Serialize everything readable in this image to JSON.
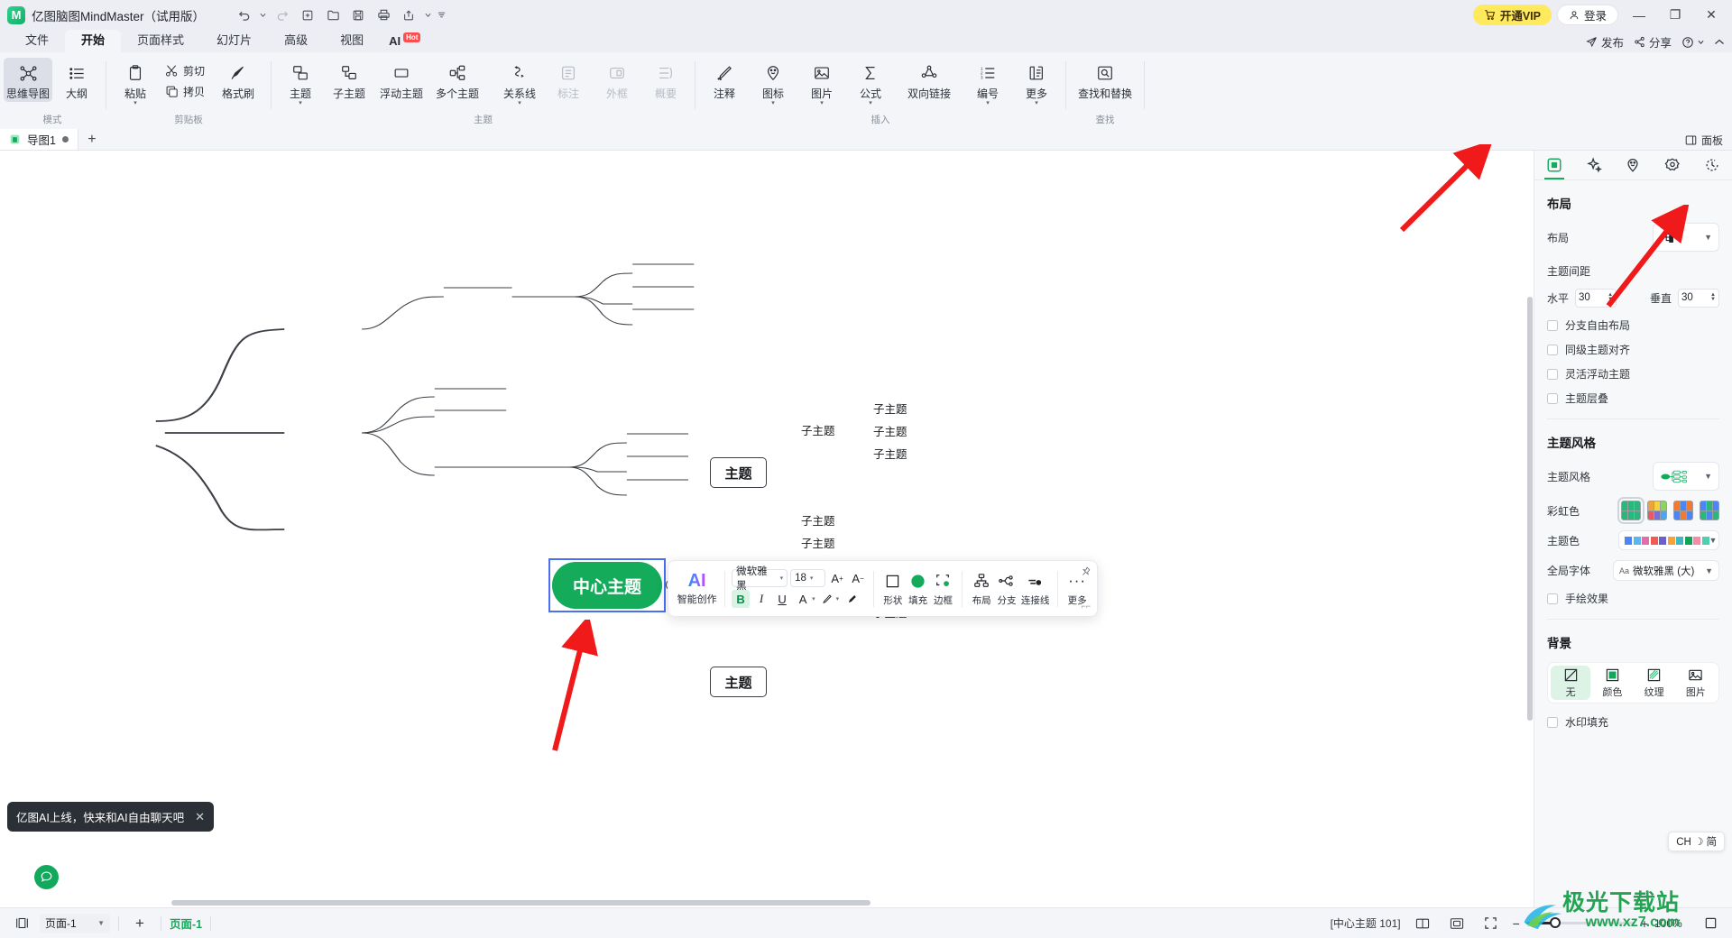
{
  "titlebar": {
    "app_title": "亿图脑图MindMaster（试用版）",
    "logo_glyph": "M",
    "quick_access": [
      {
        "name": "undo-icon",
        "glyph": "↺"
      },
      {
        "name": "undo-dropdown-icon",
        "glyph": "▾"
      },
      {
        "name": "redo-icon",
        "glyph": "↻"
      },
      {
        "name": "new-icon",
        "glyph": "＋"
      },
      {
        "name": "open-icon",
        "glyph": "🗁"
      },
      {
        "name": "save-icon",
        "glyph": "🖫"
      },
      {
        "name": "print-icon",
        "glyph": "🖨"
      },
      {
        "name": "export-icon",
        "glyph": "↗"
      },
      {
        "name": "export-dropdown-icon",
        "glyph": "▾"
      },
      {
        "name": "more-qat-icon",
        "glyph": "⩲"
      }
    ],
    "vip_label": "开通VIP",
    "login_label": "登录",
    "minimize": "—",
    "maximize": "❐",
    "close": "✕"
  },
  "menubar": {
    "items": [
      "文件",
      "开始",
      "页面样式",
      "幻灯片",
      "高级",
      "视图"
    ],
    "active": "开始",
    "ai_label": "AI",
    "ai_badge": "Hot",
    "right_items": [
      {
        "name": "publish",
        "label": "发布",
        "icon": "send-icon"
      },
      {
        "name": "share",
        "label": "分享",
        "icon": "share-icon"
      },
      {
        "name": "help",
        "label": "",
        "icon": "help-icon"
      },
      {
        "name": "collapse-ribbon",
        "label": "",
        "icon": "chevron-up-icon"
      }
    ]
  },
  "ribbon": {
    "groups": [
      {
        "label": "模式",
        "items": [
          {
            "name": "mindmap-mode",
            "label": "思维导图",
            "icon": "mindmap-icon",
            "active": true,
            "caret": false
          },
          {
            "name": "outline-mode",
            "label": "大纲",
            "icon": "outline-icon",
            "active": false,
            "caret": false
          }
        ]
      },
      {
        "label": "剪贴板",
        "items": [
          {
            "name": "paste",
            "label": "粘贴",
            "icon": "paste-icon",
            "caret": true
          },
          {
            "name": "cut",
            "label": "剪切",
            "icon": "scissors-icon",
            "caret": false
          },
          {
            "name": "copy",
            "label": "拷贝",
            "icon": "copy-icon",
            "caret": false
          },
          {
            "name": "format-painter",
            "label": "格式刷",
            "icon": "brush-icon",
            "caret": false
          }
        ]
      },
      {
        "label": "主题",
        "items": [
          {
            "name": "topic",
            "label": "主题",
            "icon": "topic-icon",
            "caret": true
          },
          {
            "name": "subtopic",
            "label": "子主题",
            "icon": "subtopic-icon",
            "caret": false
          },
          {
            "name": "floating-topic",
            "label": "浮动主题",
            "icon": "floating-topic-icon",
            "caret": false
          },
          {
            "name": "multi-topic",
            "label": "多个主题",
            "icon": "multi-topic-icon",
            "caret": false
          },
          {
            "name": "relation-line",
            "label": "关系线",
            "icon": "relation-line-icon",
            "caret": true
          },
          {
            "name": "callout",
            "label": "标注",
            "icon": "callout-icon",
            "caret": false,
            "disabled": true
          },
          {
            "name": "boundary",
            "label": "外框",
            "icon": "boundary-icon",
            "caret": false,
            "disabled": true
          },
          {
            "name": "summary",
            "label": "概要",
            "icon": "summary-icon",
            "caret": false,
            "disabled": true
          }
        ]
      },
      {
        "label": "插入",
        "items": [
          {
            "name": "comment",
            "label": "注释",
            "icon": "pencil-note-icon",
            "caret": false
          },
          {
            "name": "icon-insert",
            "label": "图标",
            "icon": "emoji-pin-icon",
            "caret": true
          },
          {
            "name": "image-insert",
            "label": "图片",
            "icon": "picture-icon",
            "caret": true
          },
          {
            "name": "formula",
            "label": "公式",
            "icon": "sigma-icon",
            "caret": true
          },
          {
            "name": "bidirectional-link",
            "label": "双向链接",
            "icon": "link-nodes-icon",
            "caret": false
          },
          {
            "name": "numbering",
            "label": "编号",
            "icon": "numbered-list-icon",
            "caret": true
          },
          {
            "name": "more-insert",
            "label": "更多",
            "icon": "more-panel-icon",
            "caret": true
          }
        ]
      },
      {
        "label": "查找",
        "items": [
          {
            "name": "find-replace",
            "label": "查找和替换",
            "icon": "find-replace-icon",
            "caret": false
          }
        ]
      }
    ]
  },
  "tabstrip": {
    "doc_tab": "导图1",
    "add_tab": "+",
    "panel_toggle": "面板"
  },
  "mindmap": {
    "center": "中心主题",
    "topics": [
      "主题",
      "主题",
      "主题"
    ],
    "subtopic_label": "子主题",
    "branches": [
      {
        "topic": "主题",
        "children": [
          {
            "label": "子主题",
            "grandchildren": [
              "子主题",
              "子主题",
              "子主题"
            ]
          }
        ]
      },
      {
        "topic": "主题",
        "children": [
          {
            "label": "子主题",
            "grandchildren": []
          },
          {
            "label": "子主题",
            "grandchildren": []
          },
          {
            "label": "子主题",
            "grandchildren": [
              "子主题",
              "子主题",
              "子主题"
            ]
          }
        ]
      },
      {
        "topic": "主题",
        "children": []
      }
    ]
  },
  "float_toolbar": {
    "ai_title": "AI",
    "ai_sub": "智能创作",
    "font_family": "微软雅黑",
    "font_size": "18",
    "font_grow": "A",
    "font_shrink": "A",
    "bold": "B",
    "italic": "I",
    "underline": "U",
    "font_color": "A",
    "highlight": "✎",
    "clear_format": "✦",
    "groups": [
      {
        "name": "shape",
        "label": "形状",
        "icon": "square-icon"
      },
      {
        "name": "fill",
        "label": "填充",
        "icon": "fill-circle-icon"
      },
      {
        "name": "border",
        "label": "边框",
        "icon": "border-icon"
      },
      {
        "name": "layout",
        "label": "布局",
        "icon": "layout-tree-icon"
      },
      {
        "name": "branch",
        "label": "分支",
        "icon": "branch-icon"
      },
      {
        "name": "connector",
        "label": "连接线",
        "icon": "connector-icon"
      },
      {
        "name": "more",
        "label": "更多",
        "icon": "ellipsis-icon"
      }
    ],
    "pin_icon": "📌"
  },
  "right_panel": {
    "tabs": [
      {
        "name": "style-tab",
        "icon": "panel-style-icon",
        "active": true
      },
      {
        "name": "ai-tab",
        "icon": "sparkle-icon",
        "active": false
      },
      {
        "name": "emoji-tab",
        "icon": "smiley-pin-icon",
        "active": false
      },
      {
        "name": "sticker-tab",
        "icon": "flower-icon",
        "active": false
      },
      {
        "name": "history-tab",
        "icon": "clock-icon",
        "active": false
      }
    ],
    "layout_section": "布局",
    "layout_label": "布局",
    "spacing_label": "主题间距",
    "horizontal_label": "水平",
    "horizontal_value": "30",
    "vertical_label": "垂直",
    "vertical_value": "30",
    "checkboxes": [
      "分支自由布局",
      "同级主题对齐",
      "灵活浮动主题",
      "主题层叠"
    ],
    "style_section": "主题风格",
    "style_label": "主题风格",
    "rainbow_label": "彩虹色",
    "theme_color_label": "主题色",
    "global_font_label": "全局字体",
    "global_font_value": "微软雅黑 (大)",
    "global_font_prefix": "Aa",
    "hand_draw_label": "手绘效果",
    "background_section": "背景",
    "background_items": [
      {
        "name": "bg-none",
        "label": "无",
        "selected": true
      },
      {
        "name": "bg-color",
        "label": "颜色",
        "selected": false
      },
      {
        "name": "bg-texture",
        "label": "纹理",
        "selected": false
      },
      {
        "name": "bg-image",
        "label": "图片",
        "selected": false
      }
    ],
    "watermark_label": "水印填充",
    "theme_color_swatches": [
      "#4a86f7",
      "#5bb6f0",
      "#e06fa8",
      "#f05b52",
      "#6b5fd0",
      "#f3a33a",
      "#3fb8c4",
      "#11a456",
      "#f58ba6",
      "#4ecfb0"
    ],
    "ime_pill": "CH ☽ 简"
  },
  "toast": {
    "message": "亿图AI上线，快来和AI自由聊天吧",
    "close": "✕"
  },
  "status_bar": {
    "page_select": "页面-1",
    "add_page": "+",
    "current_page": "页面-1",
    "selection_info": "[中心主题 101]",
    "zoom_value": "100%",
    "view_buttons": [
      "split-view-icon",
      "fit-page-icon",
      "fullscreen-icon"
    ],
    "zoom_out": "−",
    "zoom_in": "+"
  },
  "watermark": {
    "big": "极光下载站",
    "small": "www.xz7.com"
  },
  "colors": {
    "accent_green": "#14ab5b",
    "vip_yellow": "#ffe95c",
    "select_blue": "#4b6ef5",
    "arrow_red": "#f01a1a"
  }
}
